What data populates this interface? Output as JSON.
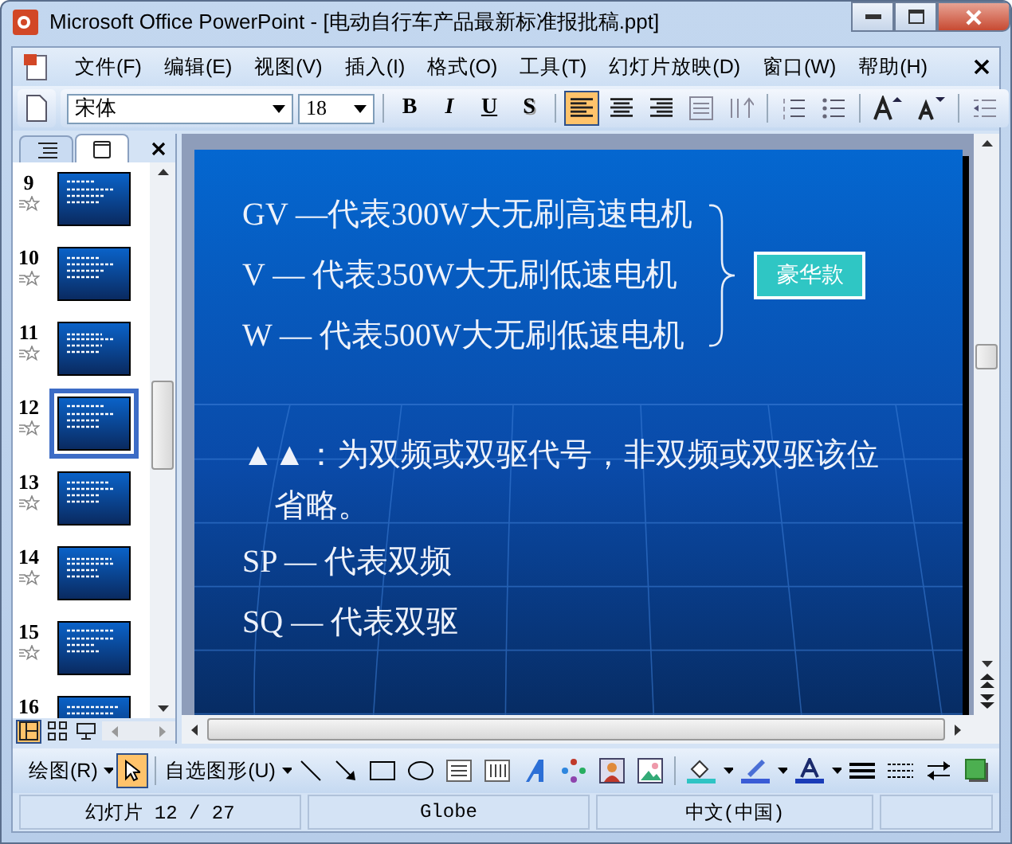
{
  "window": {
    "title": "Microsoft Office PowerPoint - [电动自行车产品最新标准报批稿.ppt]"
  },
  "menu": [
    "文件(F)",
    "编辑(E)",
    "视图(V)",
    "插入(I)",
    "格式(O)",
    "工具(T)",
    "幻灯片放映(D)",
    "窗口(W)",
    "帮助(H)"
  ],
  "format_toolbar": {
    "font": "宋体",
    "size": "18",
    "style_buttons": [
      {
        "label": "B",
        "kind": "bold"
      },
      {
        "label": "I",
        "kind": "italic"
      },
      {
        "label": "U",
        "kind": "underline"
      },
      {
        "label": "S",
        "kind": "shadow"
      }
    ],
    "alignment": [
      {
        "kind": "left",
        "selected": true
      },
      {
        "kind": "center",
        "selected": false
      },
      {
        "kind": "right",
        "selected": false
      }
    ]
  },
  "slide_panel": {
    "tabs": [
      {
        "kind": "outline",
        "selected": false
      },
      {
        "kind": "slides",
        "selected": true
      }
    ],
    "thumbnails": [
      {
        "number": "9",
        "selected": false
      },
      {
        "number": "10",
        "selected": false
      },
      {
        "number": "11",
        "selected": false
      },
      {
        "number": "12",
        "selected": true
      },
      {
        "number": "13",
        "selected": false
      },
      {
        "number": "14",
        "selected": false
      },
      {
        "number": "15",
        "selected": false
      },
      {
        "number": "16",
        "selected": false
      }
    ],
    "views": [
      {
        "kind": "normal",
        "selected": true
      },
      {
        "kind": "sorter",
        "selected": false
      },
      {
        "kind": "show",
        "selected": false
      }
    ]
  },
  "slide": {
    "motor_lines": [
      "GV —代表300W大无刷高速电机",
      "V — 代表350W大无刷低速电机",
      "W — 代表500W大无刷低速电机"
    ],
    "badge": "豪华款",
    "note": "▲▲：为双频或双驱代号，非双频或双驱该位省略。",
    "drive_lines": [
      "SP — 代表双频",
      "SQ — 代表双驱"
    ]
  },
  "drawing_toolbar": {
    "draw_menu": "绘图(R)",
    "pointer": {
      "selected": true
    },
    "autoshapes_menu": "自选图形(U)"
  },
  "status_bar": [
    "幻灯片 12 / 27",
    "Globe",
    "中文(中国)"
  ]
}
